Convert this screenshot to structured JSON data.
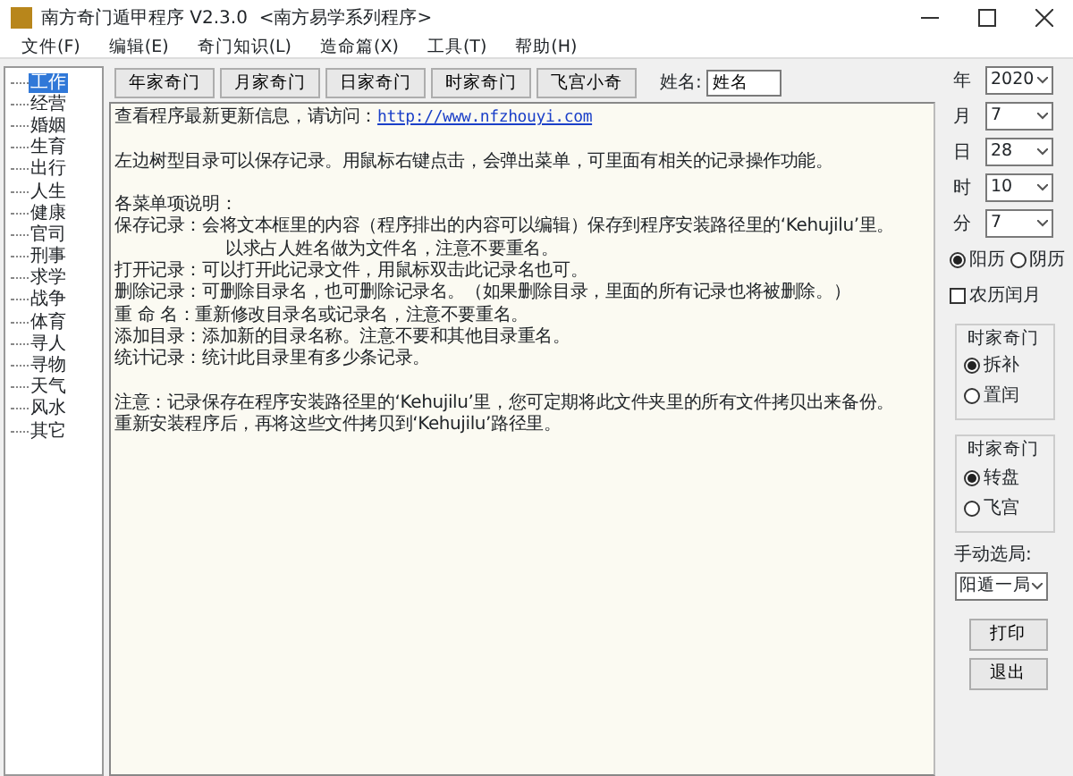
{
  "window": {
    "title": "南方奇门遁甲程序 V2.3.0  <南方易学系列程序>"
  },
  "menu": [
    "文件(F)",
    "编辑(E)",
    "奇门知识(L)",
    "造命篇(X)",
    "工具(T)",
    "帮助(H)"
  ],
  "tree": [
    {
      "label": "工作",
      "selected": true
    },
    {
      "label": "经营",
      "selected": false
    },
    {
      "label": "婚姻",
      "selected": false
    },
    {
      "label": "生育",
      "selected": false
    },
    {
      "label": "出行",
      "selected": false
    },
    {
      "label": "人生",
      "selected": false
    },
    {
      "label": "健康",
      "selected": false
    },
    {
      "label": "官司",
      "selected": false
    },
    {
      "label": "刑事",
      "selected": false
    },
    {
      "label": "求学",
      "selected": false
    },
    {
      "label": "战争",
      "selected": false
    },
    {
      "label": "体育",
      "selected": false
    },
    {
      "label": "寻人",
      "selected": false
    },
    {
      "label": "寻物",
      "selected": false
    },
    {
      "label": "天气",
      "selected": false
    },
    {
      "label": "风水",
      "selected": false
    },
    {
      "label": "其它",
      "selected": false
    }
  ],
  "toolbar": {
    "buttons": [
      "年家奇门",
      "月家奇门",
      "日家奇门",
      "时家奇门",
      "飞宫小奇"
    ],
    "name_label": "姓名:",
    "name_value": "姓名"
  },
  "text_blocks": [
    [
      {
        "kind": "link_line",
        "text": "查看程序最新更新信息，请访问：",
        "link": "http://www.nfzhouyi.com"
      }
    ],
    [
      {
        "kind": "line",
        "text": "左边树型目录可以保存记录。用鼠标右键点击，会弹出菜单，可里面有相关的记录操作功能。"
      }
    ],
    [
      {
        "kind": "line",
        "text": "各菜单项说明："
      },
      {
        "kind": "line",
        "text": "保存记录：会将文本框里的内容（程序排出的内容可以编辑）保存到程序安装路径里的‘Kehujilu’里。"
      },
      {
        "kind": "continuation",
        "text": "以求占人姓名做为文件名，注意不要重名。"
      },
      {
        "kind": "line",
        "text": "打开记录：可以打开此记录文件，用鼠标双击此记录名也可。"
      },
      {
        "kind": "line",
        "text": "删除记录：可删除目录名，也可删除记录名。（如果删除目录，里面的所有记录也将被删除。）"
      },
      {
        "kind": "line",
        "text": "重 命 名：重新修改目录名或记录名，注意不要重名。"
      },
      {
        "kind": "line",
        "text": "添加目录：添加新的目录名称。注意不要和其他目录重名。"
      },
      {
        "kind": "line",
        "text": "统计记录：统计此目录里有多少条记录。"
      }
    ],
    [
      {
        "kind": "line",
        "text": "注意：记录保存在程序安装路径里的‘Kehujilu’里，您可定期将此文件夹里的所有文件拷贝出来备份。"
      },
      {
        "kind": "line",
        "text": "重新安装程序后，再将这些文件拷贝到‘Kehujilu’路径里。"
      }
    ]
  ],
  "date": [
    {
      "label": "年",
      "value": "2020"
    },
    {
      "label": "月",
      "value": "7"
    },
    {
      "label": "日",
      "value": "28"
    },
    {
      "label": "时",
      "value": "10"
    },
    {
      "label": "分",
      "value": "7"
    }
  ],
  "calendar": [
    {
      "label": "阳历",
      "selected": true
    },
    {
      "label": "阴历",
      "selected": false
    }
  ],
  "leap_month": {
    "label": "农历闰月",
    "checked": false
  },
  "groups": [
    {
      "title": "时家奇门",
      "options": [
        {
          "label": "拆补",
          "selected": true
        },
        {
          "label": "置闰",
          "selected": false
        }
      ]
    },
    {
      "title": "时家奇门",
      "options": [
        {
          "label": "转盘",
          "selected": true
        },
        {
          "label": "飞宫",
          "selected": false
        }
      ]
    }
  ],
  "manual": {
    "label": "手动选局:",
    "value": "阳遁一局"
  },
  "buttons": [
    "打印",
    "退出"
  ]
}
